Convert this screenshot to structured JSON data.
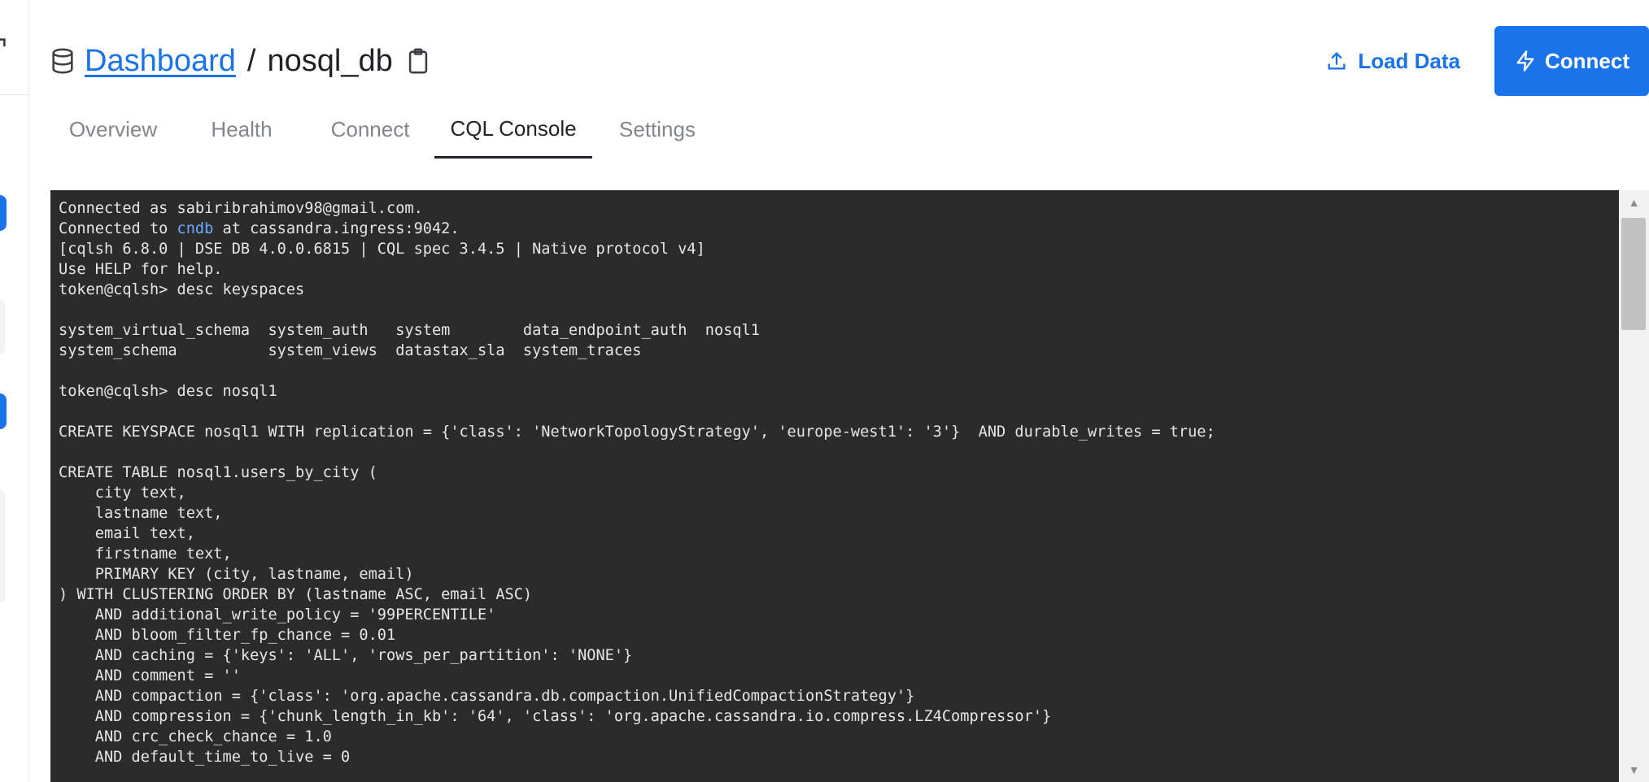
{
  "breadcrumb": {
    "root_label": "Dashboard",
    "separator": "/",
    "db_name": "nosql_db"
  },
  "actions": {
    "load_data_label": "Load Data",
    "connect_label": "Connect"
  },
  "tabs": [
    {
      "label": "Overview"
    },
    {
      "label": "Health"
    },
    {
      "label": "Connect"
    },
    {
      "label": "CQL Console",
      "active": true
    },
    {
      "label": "Settings"
    }
  ],
  "console": {
    "lines": [
      "Connected as sabiribrahimov98@gmail.com.",
      "Connected to cndb at cassandra.ingress:9042.",
      "[cqlsh 6.8.0 | DSE DB 4.0.0.6815 | CQL spec 3.4.5 | Native protocol v4]",
      "Use HELP for help.",
      "token@cqlsh> desc keyspaces",
      "",
      "system_virtual_schema  system_auth   system        data_endpoint_auth  nosql1",
      "system_schema          system_views  datastax_sla  system_traces",
      "",
      "token@cqlsh> desc nosql1",
      "",
      "CREATE KEYSPACE nosql1 WITH replication = {'class': 'NetworkTopologyStrategy', 'europe-west1': '3'}  AND durable_writes = true;",
      "",
      "CREATE TABLE nosql1.users_by_city (",
      "    city text,",
      "    lastname text,",
      "    email text,",
      "    firstname text,",
      "    PRIMARY KEY (city, lastname, email)",
      ") WITH CLUSTERING ORDER BY (lastname ASC, email ASC)",
      "    AND additional_write_policy = '99PERCENTILE'",
      "    AND bloom_filter_fp_chance = 0.01",
      "    AND caching = {'keys': 'ALL', 'rows_per_partition': 'NONE'}",
      "    AND comment = ''",
      "    AND compaction = {'class': 'org.apache.cassandra.db.compaction.UnifiedCompactionStrategy'}",
      "    AND compression = {'chunk_length_in_kb': '64', 'class': 'org.apache.cassandra.io.compress.LZ4Compressor'}",
      "    AND crc_check_chance = 1.0",
      "    AND default_time_to_live = 0"
    ],
    "highlight_word": "cndb"
  },
  "colors": {
    "accent": "#1a73e8",
    "console_bg": "#2b2b2b",
    "console_fg": "#e6e6e6",
    "console_highlight": "#6ea8ff"
  },
  "icons": {
    "database": "database-icon",
    "copy": "clipboard-icon",
    "upload": "upload-icon",
    "bolt": "bolt-icon",
    "chevron": "chevron-icon"
  }
}
